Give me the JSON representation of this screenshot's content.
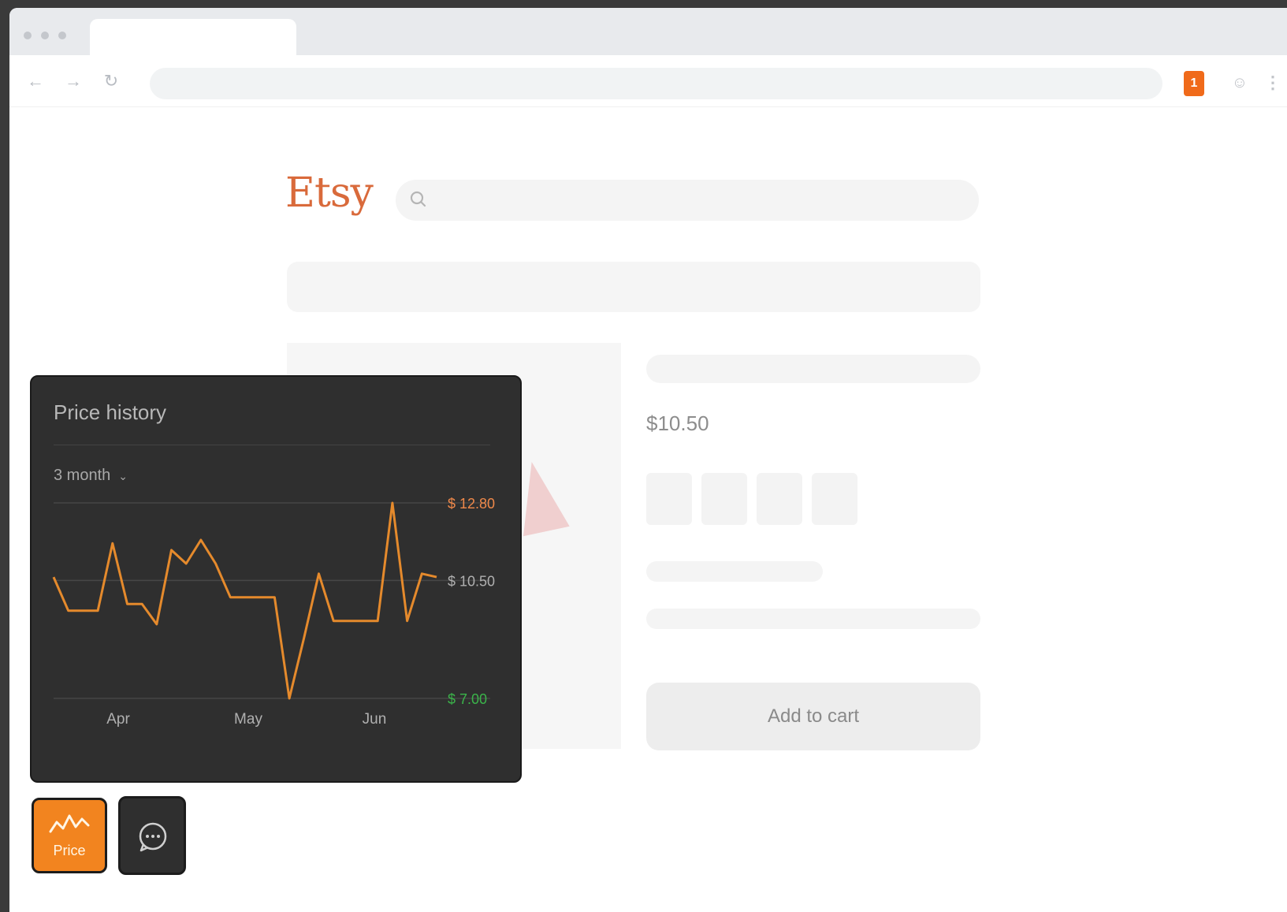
{
  "browser": {
    "extension_badge": "1",
    "menu_glyph": "⋮",
    "icons": [
      "back-arrow-icon",
      "forward-arrow-icon",
      "reload-icon",
      "extension-icon",
      "profile-icon",
      "menu-icon"
    ]
  },
  "site": {
    "logo": "Etsy",
    "accent_color": "#d96a3b"
  },
  "product": {
    "price": "$10.50",
    "add_to_cart_label": "Add to cart"
  },
  "price_panel": {
    "title": "Price history",
    "period": "3 month",
    "period_arrow": "⌄",
    "line_color": "#e58a2c",
    "low_color": "#3bb44a",
    "high_color": "#f0894a"
  },
  "chart_data": {
    "type": "line",
    "x_ticks": [
      "Apr",
      "May",
      "Jun"
    ],
    "y_ticks": [
      {
        "value": 12.8,
        "label": "$ 12.80"
      },
      {
        "value": 10.5,
        "label": "$ 10.50"
      },
      {
        "value": 7.0,
        "label": "$ 7.00"
      }
    ],
    "ylim": [
      7.0,
      12.8
    ],
    "grid": true,
    "series": [
      {
        "values": [
          10.6,
          9.6,
          9.6,
          9.6,
          11.6,
          9.8,
          9.8,
          9.2,
          11.4,
          11.0,
          11.7,
          11.0,
          10.0,
          10.0,
          10.0,
          10.0,
          7.0,
          8.8,
          10.7,
          9.3,
          9.3,
          9.3,
          9.3,
          12.8,
          9.3,
          10.7,
          10.6
        ]
      }
    ]
  },
  "widgets": {
    "price_button_label": "Price",
    "chat_icon": "chat-bubble-icon"
  }
}
